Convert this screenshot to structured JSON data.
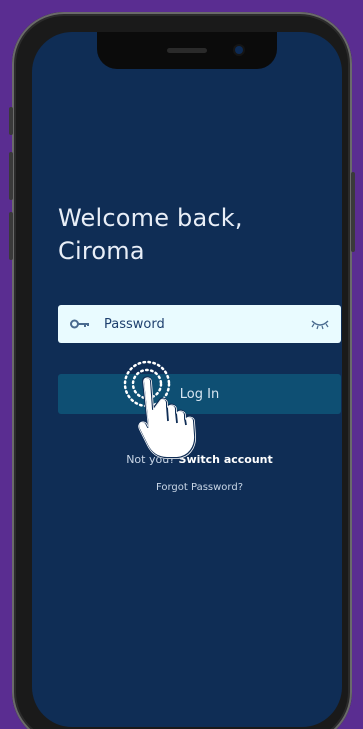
{
  "welcome": {
    "line1": "Welcome back,",
    "line2": "Ciroma"
  },
  "password": {
    "placeholder": "Password",
    "value": "",
    "leading_icon": "key-icon",
    "trailing_icon": "eye-closed-icon"
  },
  "login": {
    "label": "Log In"
  },
  "switch": {
    "prefix": "Not you?",
    "link": "Switch account"
  },
  "forgot": {
    "label": "Forgot Password?"
  },
  "colors": {
    "background": "#5a2d91",
    "screen": "#0f2d55",
    "field": "#e9fbff",
    "button": "#0e4f73"
  }
}
